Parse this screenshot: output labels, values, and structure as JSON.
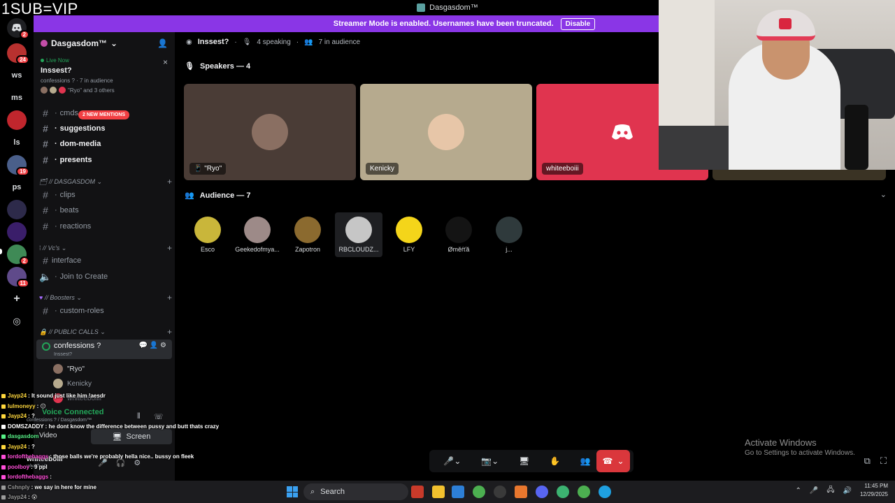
{
  "overlay": {
    "title": "1SUB=VIP"
  },
  "window": {
    "title": "Dasgasdom™"
  },
  "banner": {
    "text": "Streamer Mode is enabled. Usernames have been truncated.",
    "disable_label": "Disable"
  },
  "rail": {
    "items": [
      {
        "label": "",
        "badge": "2"
      },
      {
        "label": "",
        "badge": "24"
      },
      {
        "label": "ws",
        "badge": ""
      },
      {
        "label": "ms",
        "badge": ""
      },
      {
        "label": "",
        "badge": ""
      },
      {
        "label": "ls",
        "badge": ""
      },
      {
        "label": "",
        "badge": "19"
      },
      {
        "label": "ps",
        "badge": ""
      },
      {
        "label": "",
        "badge": ""
      },
      {
        "label": "",
        "badge": ""
      },
      {
        "label": "",
        "badge": "2"
      },
      {
        "label": "",
        "badge": "11"
      }
    ]
  },
  "sidebar": {
    "server_name": "Dasgasdom™",
    "live": {
      "status": "Live Now",
      "title": "Inssest?",
      "meta": "confessions ? · 7 in audience",
      "others": "\"Ryo\" and 3 others"
    },
    "mention_pill": "2 NEW MENTIONS",
    "channels": {
      "cmds": "cmds",
      "suggestions": "suggestions",
      "dom_media": "dom-media",
      "presents": "presents",
      "cat_dasgasdom": "// DASGASDOM",
      "clips": "clips",
      "beats": "beats",
      "reactions": "reactions",
      "cat_vcs": "// Vc's",
      "interface": "interface",
      "join_to_create": "Join to Create",
      "cat_boosters": "// Boosters",
      "custom_roles": "custom-roles",
      "cat_public_calls": "// PUBLIC CALLS",
      "confessions": "confessions ?",
      "confessions_sub": "Inssest?"
    },
    "vc_users": [
      "\"Ryo\"",
      "Kenicky",
      "whiteeboiiii"
    ],
    "user_panel": {
      "voice_status": "Voice Connected",
      "voice_sub": "confessions ? / Dasgasdom™",
      "video_label": "Video",
      "screen_label": "Screen",
      "username": "whiteeboiii",
      "usertag": "what? +1"
    }
  },
  "stage": {
    "title": "Inssest?",
    "speaking": "4 speaking",
    "audience_count": "7 in audience",
    "speakers_label": "Speakers — 4",
    "audience_label": "Audience — 7",
    "speakers": [
      {
        "name": "\"Ryo\"",
        "bg": "#4a3c36",
        "avatar": "#8a6f62"
      },
      {
        "name": "Kenicky",
        "bg": "#b6aa8e",
        "avatar": "#e7c6a8"
      },
      {
        "name": "whiteeboiii",
        "bg": "#e0344f",
        "avatar": ""
      },
      {
        "name": "",
        "bg": "#3a3324",
        "avatar": ""
      }
    ],
    "audience": [
      {
        "name": "Esco",
        "color": "#c9b63a"
      },
      {
        "name": "Geekedofmya...",
        "color": "#9d8a88"
      },
      {
        "name": "Zapotron",
        "color": "#8b6a2f"
      },
      {
        "name": "RBCLOUDZ...",
        "color": "#c6c6c6"
      },
      {
        "name": "LFY",
        "color": "#f4d51a"
      },
      {
        "name": "Øměŕťă",
        "color": "#141414"
      },
      {
        "name": "j...",
        "color": "#2f3a3c"
      }
    ]
  },
  "activate_windows": {
    "line1": "Activate Windows",
    "line2": "Go to Settings to activate Windows."
  },
  "chat": [
    {
      "user": "Jayp24",
      "text": ": It sound just like him !aesdr",
      "color": "#ffd83d"
    },
    {
      "user": "lulmoneyy",
      "text": ": 😐",
      "color": "#ffd83d"
    },
    {
      "user": "Jayp24",
      "text": ": ?",
      "color": "#ffd83d"
    },
    {
      "user": "DOMSZADDY",
      "text": ": he dont know the difference between pussy and butt thats crazy",
      "color": "#ffffff"
    },
    {
      "user": "dasgasdom",
      "text": "",
      "color": "#57f287"
    },
    {
      "user": "Jayp24",
      "text": ": ?",
      "color": "#ffd83d"
    },
    {
      "user": "lordofthebaggs",
      "text": ": those balls we're probably hella nice.. bussy on fleek",
      "color": "#ff4fd8"
    },
    {
      "user": "poolboy",
      "text": ": 9 ppl",
      "color": "#ff4fd8"
    },
    {
      "user": "lordofthebaggs",
      "text": ":",
      "color": "#ff4fd8"
    },
    {
      "user": "Cshnply",
      "text": ": we say in here for mine",
      "color": "#9b9b9b"
    },
    {
      "user": "Jayp24",
      "text": ": 😮",
      "color": "#9b9b9b"
    }
  ],
  "taskbar": {
    "search_label": "Search",
    "time": "11:45 PM",
    "date": "12/29/2025"
  }
}
